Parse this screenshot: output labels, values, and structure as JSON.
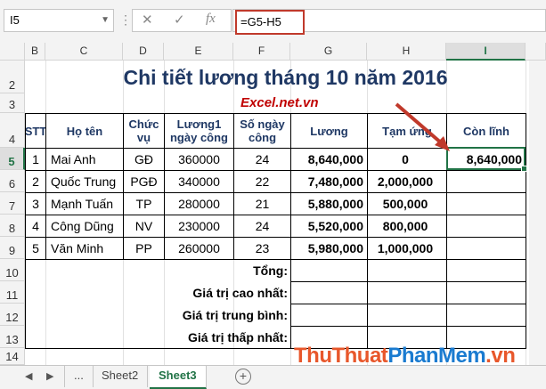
{
  "formula_bar": {
    "name_box": "I5",
    "formula": "=G5-H5",
    "cancel_icon": "✕",
    "enter_icon": "✓",
    "fx_label": "fx"
  },
  "columns": [
    "B",
    "C",
    "D",
    "E",
    "F",
    "G",
    "H",
    "I"
  ],
  "rows": [
    "2",
    "3",
    "4",
    "5",
    "6",
    "7",
    "8",
    "9",
    "10",
    "11",
    "12",
    "13",
    "14"
  ],
  "sheet": {
    "title": "Chi tiết lương tháng 10 năm 2016",
    "subtitle": "Excel.net.vn",
    "headers": {
      "stt": "STT",
      "ho_ten": "Họ tên",
      "chuc_vu": "Chức vụ",
      "luong1": "Lương1 ngày công",
      "so_ngay": "Số ngày công",
      "luong": "Lương",
      "tam_ung": "Tạm ứng",
      "con_linh": "Còn lĩnh"
    },
    "data_rows": [
      {
        "stt": "1",
        "name": "Mai Anh",
        "role": "GĐ",
        "rate": "360000",
        "days": "24",
        "salary": "8,640,000",
        "advance": "0",
        "net": "8,640,000"
      },
      {
        "stt": "2",
        "name": "Quốc Trung",
        "role": "PGĐ",
        "rate": "340000",
        "days": "22",
        "salary": "7,480,000",
        "advance": "2,000,000",
        "net": ""
      },
      {
        "stt": "3",
        "name": "Mạnh Tuấn",
        "role": "TP",
        "rate": "280000",
        "days": "21",
        "salary": "5,880,000",
        "advance": "500,000",
        "net": ""
      },
      {
        "stt": "4",
        "name": "Công Dũng",
        "role": "NV",
        "rate": "230000",
        "days": "24",
        "salary": "5,520,000",
        "advance": "800,000",
        "net": ""
      },
      {
        "stt": "5",
        "name": "Văn Minh",
        "role": "PP",
        "rate": "260000",
        "days": "23",
        "salary": "5,980,000",
        "advance": "1,000,000",
        "net": ""
      }
    ],
    "summary_labels": [
      "Tổng:",
      "Giá trị cao nhất:",
      "Giá trị trung bình:",
      "Giá trị thấp nhất:"
    ]
  },
  "tabs": {
    "ellipsis": "...",
    "items": [
      "Sheet2",
      "Sheet3"
    ],
    "active": "Sheet3",
    "add": "+"
  },
  "watermark": {
    "part1": "ThuThuat",
    "part2": "PhanMem",
    "part3": ".vn"
  },
  "colors": {
    "accent": "#217346",
    "title": "#1f3864",
    "subtitle": "#c00000",
    "arrow": "#c0392b"
  }
}
